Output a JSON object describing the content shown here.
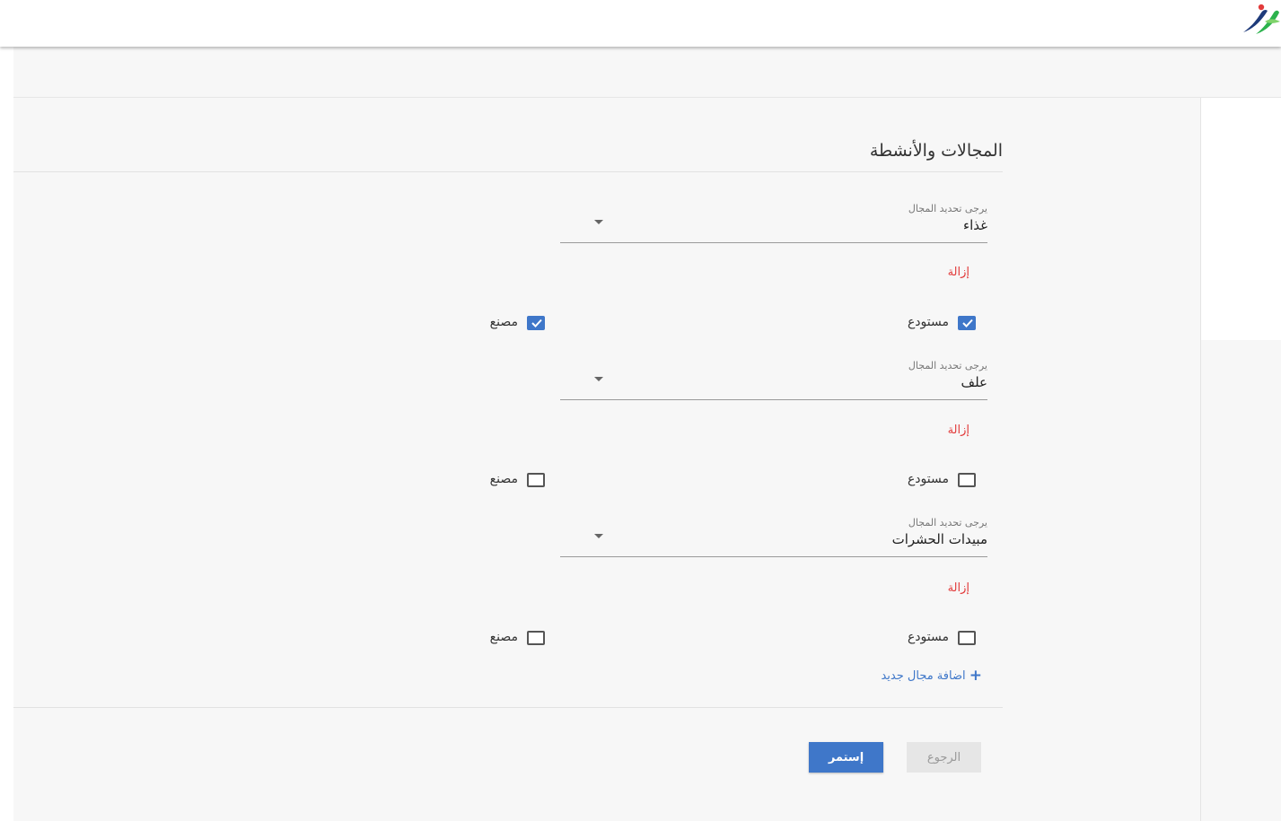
{
  "header": {
    "logo_icon": "leaf-logo-icon"
  },
  "section": {
    "title": "المجالات والأنشطة"
  },
  "fields": [
    {
      "label": "يرجى تحديد المجال",
      "value": "غذاء",
      "remove_label": "إزالة",
      "warehouse": {
        "label": "مستودع",
        "checked": true
      },
      "factory": {
        "label": "مصنع",
        "checked": true
      }
    },
    {
      "label": "يرجى تحديد المجال",
      "value": "علف",
      "remove_label": "إزالة",
      "warehouse": {
        "label": "مستودع",
        "checked": false
      },
      "factory": {
        "label": "مصنع",
        "checked": false
      }
    },
    {
      "label": "يرجى تحديد المجال",
      "value": "مبيدات الحشرات",
      "remove_label": "إزالة",
      "warehouse": {
        "label": "مستودع",
        "checked": false
      },
      "factory": {
        "label": "مصنع",
        "checked": false
      }
    }
  ],
  "add_new_label": "اضافة مجال جديد",
  "buttons": {
    "back": "الرجوع",
    "continue": "إستمر"
  },
  "colors": {
    "accent": "#3f77c9",
    "danger": "#e23b3b"
  }
}
